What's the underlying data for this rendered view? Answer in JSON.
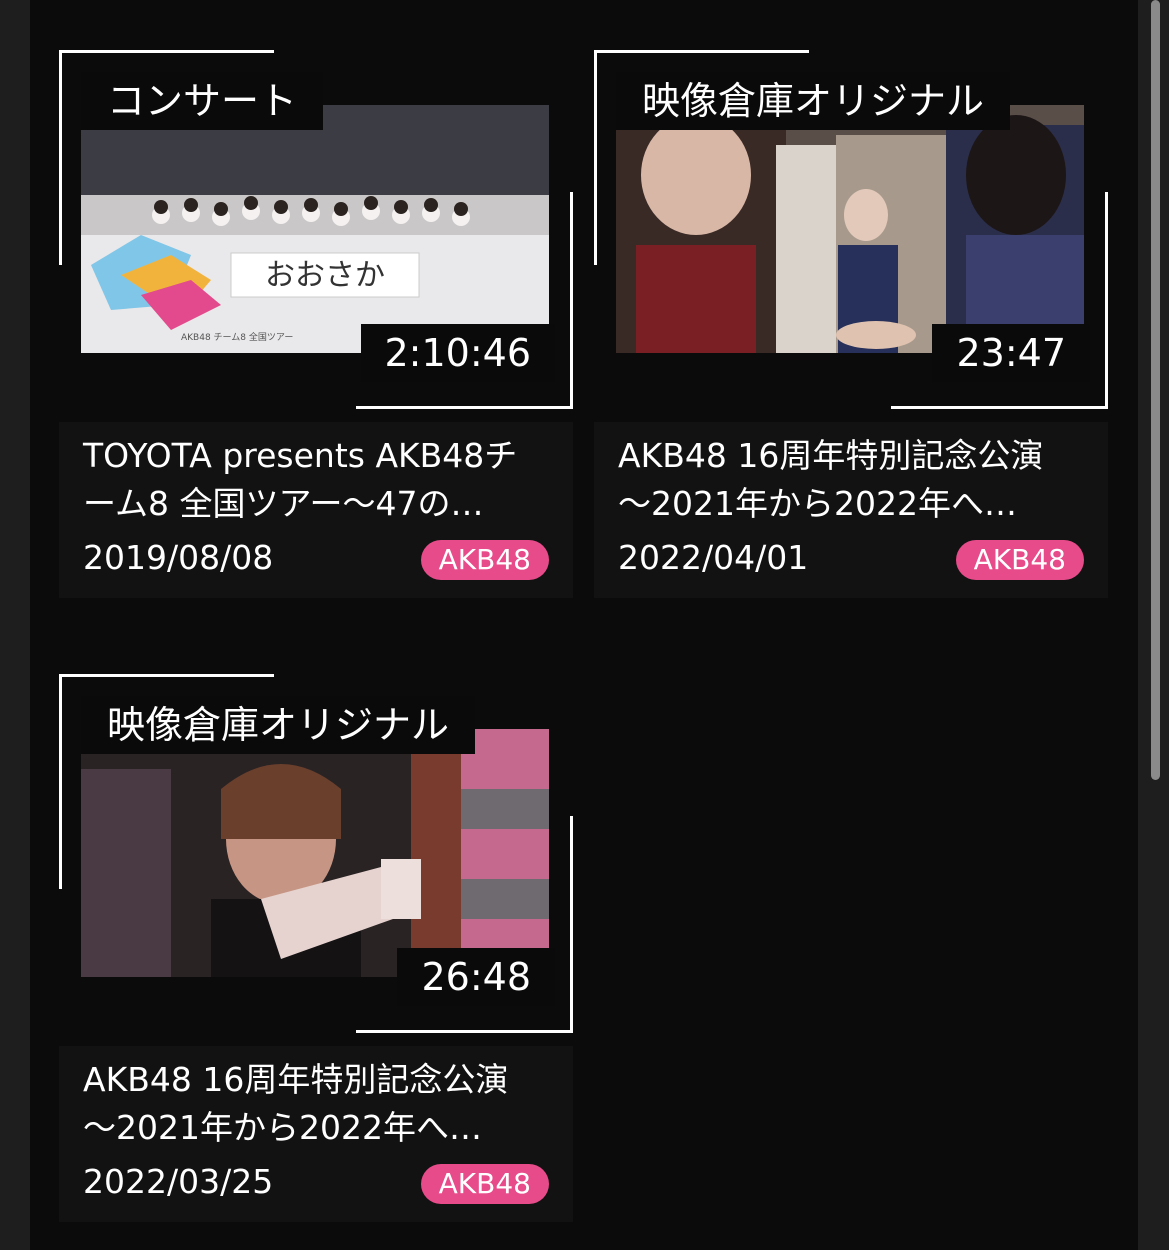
{
  "videos": [
    {
      "category": "コンサート",
      "duration": "2:10:46",
      "title_line1": "TOYOTA presents AKB48チ",
      "title_line2": "ーム8 全国ツアー〜47の…",
      "date": "2019/08/08",
      "tag": "AKB48",
      "thumb_text": "おおさか"
    },
    {
      "category": "映像倉庫オリジナル",
      "duration": "23:47",
      "title_line1": "AKB48 16周年特別記念公演",
      "title_line2": "〜2021年から2022年へ…",
      "date": "2022/04/01",
      "tag": "AKB48"
    },
    {
      "category": "映像倉庫オリジナル",
      "duration": "26:48",
      "title_line1": "AKB48 16周年特別記念公演",
      "title_line2": "〜2021年から2022年へ…",
      "date": "2022/03/25",
      "tag": "AKB48"
    }
  ],
  "colors": {
    "accent": "#e84b8a",
    "panel": "#0b0b0b",
    "background": "#1e1e1e"
  }
}
